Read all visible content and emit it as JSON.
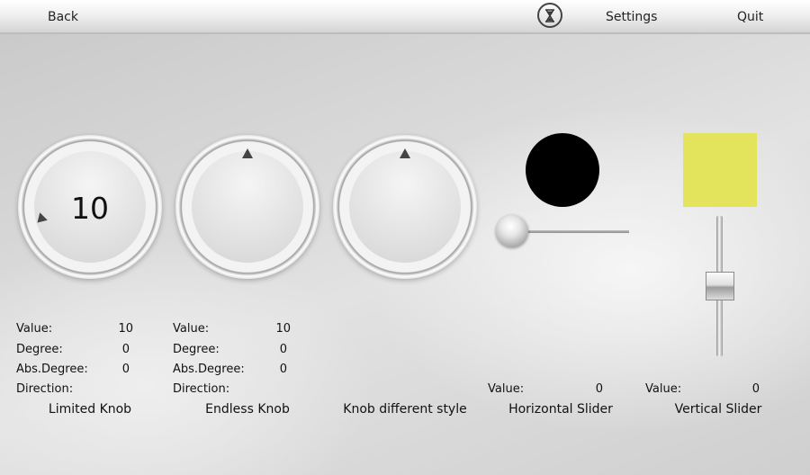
{
  "toolbar": {
    "back_label": "Back",
    "settings_label": "Settings",
    "quit_label": "Quit",
    "busy_icon": "hourglass-icon"
  },
  "knobs": [
    {
      "display_value": "10",
      "value_label": "Value:",
      "value": "10",
      "degree_label": "Degree:",
      "degree": "0",
      "abs_degree_label": "Abs.Degree:",
      "abs_degree": "0",
      "direction_label": "Direction:",
      "caption": "Limited Knob"
    },
    {
      "value_label": "Value:",
      "value": "10",
      "degree_label": "Degree:",
      "degree": "0",
      "abs_degree_label": "Abs.Degree:",
      "abs_degree": "0",
      "direction_label": "Direction:",
      "caption": "Endless Knob"
    },
    {
      "caption": "Knob different style"
    }
  ],
  "horizontal_slider": {
    "value_label": "Value:",
    "value": "0",
    "caption": "Horizontal Slider",
    "indicator_color": "#000000"
  },
  "vertical_slider": {
    "value_label": "Value:",
    "value": "0",
    "caption": "Vertical Slider",
    "indicator_color": "#e4e45c"
  }
}
